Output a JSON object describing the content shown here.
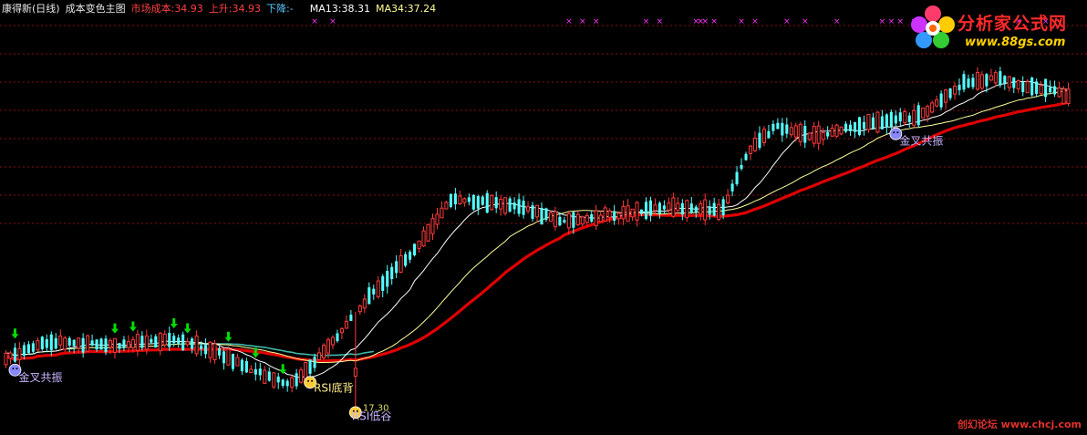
{
  "header": {
    "stock": "康得新(日线)",
    "indicator": "成本变色主图",
    "cost_label": "市场成本:",
    "cost_value": "34.93",
    "up_label": "上升:",
    "up_value": "34.93",
    "down_label": "下降:",
    "down_value": "-",
    "ma13_label": "MA13:",
    "ma13_value": "38.31",
    "ma34_label": "MA34:",
    "ma34_value": "37.24"
  },
  "logo": {
    "title": "分析家公式网",
    "url": "www.88gs.com"
  },
  "footer": "创幻论坛 www.chcj.com",
  "colors": {
    "up_candle": "#ff3b3b",
    "down_candle": "#54ffff",
    "cost_line": "#e00000",
    "ma13": "#ffffff",
    "ma34": "#ffff99",
    "grid": "#8a1010",
    "marker": "#ff33ff",
    "arrow": "#00dd00"
  },
  "chart_data": {
    "type": "candlestick",
    "title": "康得新(日线) 成本变色主图",
    "y_range": [
      16.5,
      42.5
    ],
    "grid": true,
    "annotations": [
      {
        "text": "金叉共振",
        "index": 2
      },
      {
        "text": "RSI底背",
        "index": 67
      },
      {
        "text": "RSI低谷",
        "index": 77
      },
      {
        "text": "17.30",
        "index": 77
      },
      {
        "text": "金叉共振",
        "index": 196
      }
    ],
    "series": [
      {
        "name": "MA13",
        "value_last": 38.31
      },
      {
        "name": "MA34",
        "value_last": 37.24
      },
      {
        "name": "市场成本",
        "value_last": 34.93
      }
    ],
    "top_markers": [
      68,
      72,
      124,
      127,
      130,
      141,
      144,
      152,
      153,
      154,
      156,
      162,
      165,
      172,
      176,
      183,
      193,
      195,
      197,
      200,
      223,
      229
    ],
    "green_arrows": [
      2,
      24,
      28,
      37,
      40,
      49,
      55,
      61
    ]
  }
}
